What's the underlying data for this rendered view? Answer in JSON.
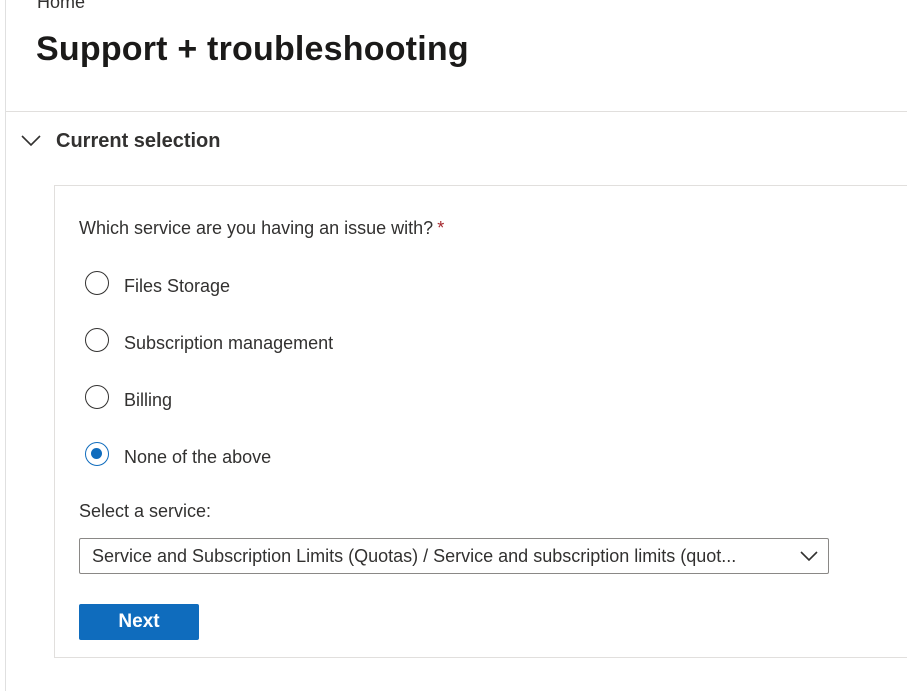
{
  "breadcrumb": {
    "label": "Home"
  },
  "page": {
    "title": "Support + troubleshooting"
  },
  "section": {
    "title": "Current selection",
    "icon": "chevron-down-icon"
  },
  "form": {
    "question": "Which service are you having an issue with?",
    "required_marker": "*",
    "options": [
      {
        "label": "Files Storage",
        "checked": false
      },
      {
        "label": "Subscription management",
        "checked": false
      },
      {
        "label": "Billing",
        "checked": false
      },
      {
        "label": "None of the above",
        "checked": true
      }
    ],
    "select_label": "Select a service:",
    "select_value": "Service and Subscription Limits (Quotas) / Service and subscription limits (quot...",
    "next_label": "Next"
  },
  "colors": {
    "accent": "#0f6cbd",
    "required": "#a4262c"
  }
}
